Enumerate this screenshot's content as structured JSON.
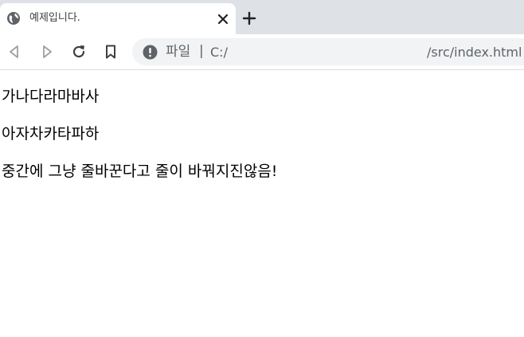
{
  "tab": {
    "title": "예제입니다.",
    "favicon": "globe-icon",
    "close": "close-icon"
  },
  "toolbar": {
    "new_tab": "plus-icon",
    "back": "back-arrow-icon",
    "forward": "forward-arrow-icon",
    "reload": "reload-icon",
    "bookmark": "bookmark-icon"
  },
  "omnibox": {
    "info_icon": "info-icon",
    "scheme_label": "파일",
    "separator": "|",
    "url_prefix": "C:/",
    "url_suffix": "/src/index.html"
  },
  "page": {
    "paragraphs": [
      "가나다라마바사",
      "아자차카타파하",
      "중간에 그냥 줄바꾼다고 줄이 바꿔지진않음!"
    ]
  },
  "colors": {
    "tabstrip": "#dee1e6",
    "omnibox": "#f1f3f4",
    "icon": "#5f6368"
  }
}
